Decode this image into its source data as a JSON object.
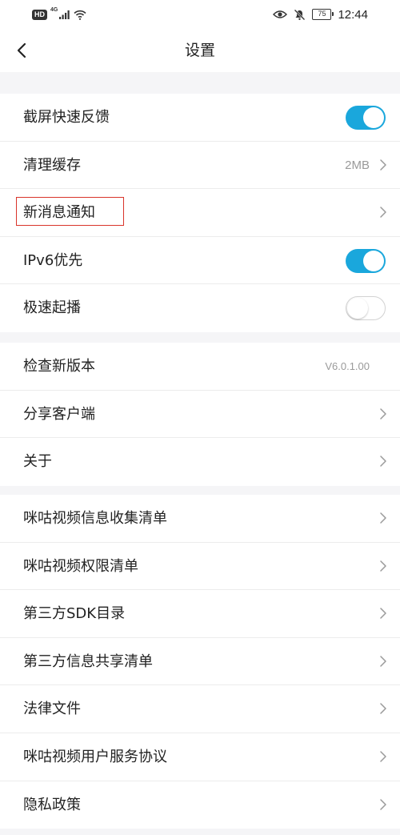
{
  "status_bar": {
    "hd_badge": "HD",
    "network_type": "4G",
    "battery": "75",
    "time": "12:44",
    "icons": [
      "signal-icon",
      "wifi-icon",
      "eye-icon",
      "mute-icon",
      "battery-icon"
    ]
  },
  "header": {
    "title": "设置",
    "back_icon": "chevron-left-icon"
  },
  "colors": {
    "toggle_on": "#1aa7dc",
    "highlight": "#d9342b",
    "secondary_text": "#9a9a9a"
  },
  "section1": {
    "items": [
      {
        "label": "截屏快速反馈",
        "toggle": true
      },
      {
        "label": "清理缓存",
        "value": "2MB"
      },
      {
        "label": "新消息通知",
        "highlighted": true
      },
      {
        "label": "IPv6优先",
        "toggle": true
      },
      {
        "label": "极速起播",
        "toggle": false
      }
    ]
  },
  "section2": {
    "items": [
      {
        "label": "检查新版本",
        "value": "V6.0.1.00"
      },
      {
        "label": "分享客户端"
      },
      {
        "label": "关于"
      }
    ]
  },
  "section3": {
    "items": [
      {
        "label": "咪咕视频信息收集清单"
      },
      {
        "label": "咪咕视频权限清单"
      },
      {
        "label": "第三方SDK目录"
      },
      {
        "label": "第三方信息共享清单"
      },
      {
        "label": "法律文件"
      },
      {
        "label": "咪咕视频用户服务协议"
      },
      {
        "label": "隐私政策"
      }
    ]
  }
}
